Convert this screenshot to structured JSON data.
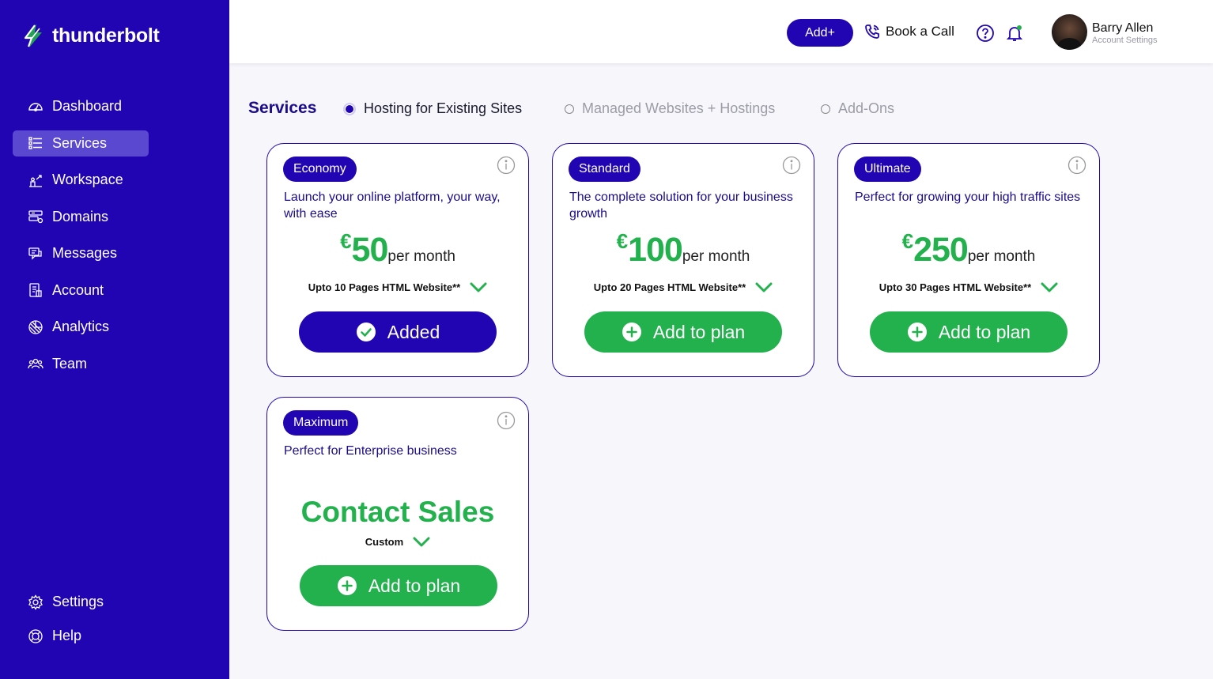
{
  "brand": {
    "name": "thunderbolt",
    "color": "#2105b3",
    "accent": "#22b14c"
  },
  "sidebar": {
    "items": [
      {
        "label": "Dashboard",
        "icon": "dashboard-gauge-icon",
        "active": false
      },
      {
        "label": "Services",
        "icon": "services-list-icon",
        "active": true
      },
      {
        "label": "Workspace",
        "icon": "workspace-icon",
        "active": false
      },
      {
        "label": "Domains",
        "icon": "domains-icon",
        "active": false
      },
      {
        "label": "Messages",
        "icon": "messages-icon",
        "active": false
      },
      {
        "label": "Account",
        "icon": "account-icon",
        "active": false
      },
      {
        "label": "Analytics",
        "icon": "analytics-pie-icon",
        "active": false
      },
      {
        "label": "Team",
        "icon": "team-icon",
        "active": false
      }
    ],
    "bottom": [
      {
        "label": "Settings",
        "icon": "gear-icon"
      },
      {
        "label": "Help",
        "icon": "lifebuoy-icon"
      }
    ]
  },
  "header": {
    "add_label": "Add+",
    "book_call_label": "Book a Call",
    "user_name": "Barry Allen",
    "user_sub": "Account Settings"
  },
  "page": {
    "title": "Services",
    "tabs": [
      {
        "label": "Hosting for Existing Sites",
        "active": true
      },
      {
        "label": "Managed Websites + Hostings",
        "active": false
      },
      {
        "label": "Add-Ons",
        "active": false
      }
    ]
  },
  "plans": [
    {
      "badge": "Economy",
      "desc": "Launch your online platform, your way, with ease",
      "currency": "€",
      "amount": "50",
      "per": "per month",
      "feature": "Upto 10 Pages HTML Website**",
      "cta": "Added",
      "added": true
    },
    {
      "badge": "Standard",
      "desc": "The complete solution for your business growth",
      "currency": "€",
      "amount": "100",
      "per": "per month",
      "feature": "Upto 20 Pages HTML Website**",
      "cta": "Add to plan",
      "added": false
    },
    {
      "badge": "Ultimate",
      "desc": "Perfect for growing your high traffic sites",
      "currency": "€",
      "amount": "250",
      "per": "per month",
      "feature": "Upto 30 Pages HTML Website**",
      "cta": "Add to plan",
      "added": false
    },
    {
      "badge": "Maximum",
      "desc": "Perfect for Enterprise business",
      "contact": "Contact Sales",
      "feature": "Custom",
      "cta": "Add to plan",
      "added": false
    }
  ]
}
